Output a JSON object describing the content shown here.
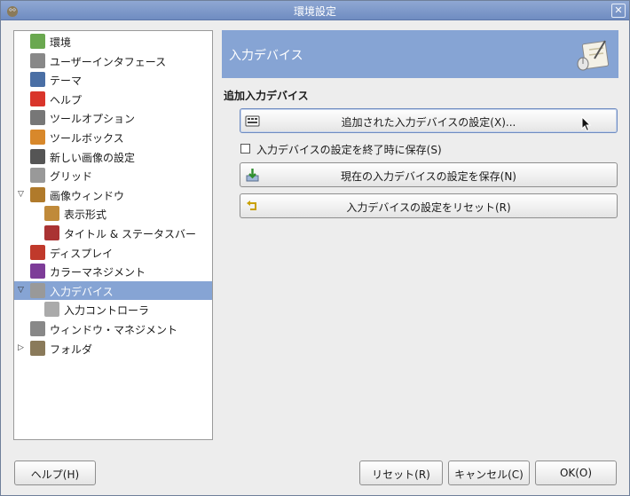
{
  "window": {
    "title": "環境設定"
  },
  "sidebar": {
    "items": [
      {
        "label": "環境",
        "icon": "environment-icon",
        "level": 0,
        "expander": ""
      },
      {
        "label": "ユーザーインタフェース",
        "icon": "user-interface-icon",
        "level": 0,
        "expander": ""
      },
      {
        "label": "テーマ",
        "icon": "theme-icon",
        "level": 0,
        "expander": ""
      },
      {
        "label": "ヘルプ",
        "icon": "help-lifebuoy-icon",
        "level": 0,
        "expander": ""
      },
      {
        "label": "ツールオプション",
        "icon": "tool-options-icon",
        "level": 0,
        "expander": ""
      },
      {
        "label": "ツールボックス",
        "icon": "toolbox-icon",
        "level": 0,
        "expander": ""
      },
      {
        "label": "新しい画像の設定",
        "icon": "new-image-icon",
        "level": 0,
        "expander": ""
      },
      {
        "label": "グリッド",
        "icon": "grid-icon",
        "level": 0,
        "expander": ""
      },
      {
        "label": "画像ウィンドウ",
        "icon": "image-window-icon",
        "level": 0,
        "expander": "expanded"
      },
      {
        "label": "表示形式",
        "icon": "appearance-icon",
        "level": 1,
        "expander": ""
      },
      {
        "label": "タイトル & ステータスバー",
        "icon": "title-statusbar-icon",
        "level": 1,
        "expander": ""
      },
      {
        "label": "ディスプレイ",
        "icon": "display-icon",
        "level": 0,
        "expander": ""
      },
      {
        "label": "カラーマネジメント",
        "icon": "color-management-icon",
        "level": 0,
        "expander": ""
      },
      {
        "label": "入力デバイス",
        "icon": "input-devices-icon",
        "level": 0,
        "expander": "expanded",
        "selected": true
      },
      {
        "label": "入力コントローラ",
        "icon": "input-controllers-icon",
        "level": 1,
        "expander": ""
      },
      {
        "label": "ウィンドウ・マネジメント",
        "icon": "window-management-icon",
        "level": 0,
        "expander": ""
      },
      {
        "label": "フォルダ",
        "icon": "folders-icon",
        "level": 0,
        "expander": "collapsed"
      }
    ]
  },
  "header": {
    "title": "入力デバイス",
    "icon": "input-devices-large-icon"
  },
  "section": {
    "title": "追加入力デバイス"
  },
  "buttons": {
    "configure_extended": "追加された入力デバイスの設定(X)...",
    "save_now": "現在の入力デバイスの設定を保存(N)",
    "reset": "入力デバイスの設定をリセット(R)"
  },
  "checkbox": {
    "label": "入力デバイスの設定を終了時に保存(S)",
    "checked": false
  },
  "footer": {
    "help": "ヘルプ(H)",
    "reset": "リセット(R)",
    "cancel": "キャンセル(C)",
    "ok": "OK(O)"
  },
  "colors": {
    "accent": "#86a4d4",
    "titlebar": "#7b96c8"
  }
}
